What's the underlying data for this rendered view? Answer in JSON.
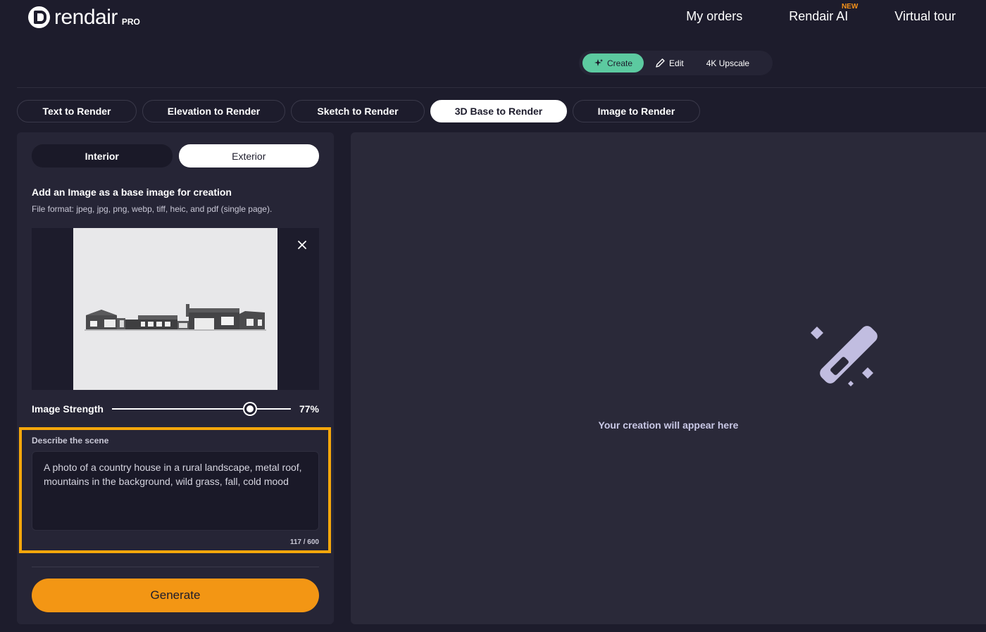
{
  "brand": {
    "name": "rendair",
    "tier": "PRO"
  },
  "nav": {
    "items": [
      {
        "label": "My orders"
      },
      {
        "label": "Rendair AI",
        "badge": "NEW"
      },
      {
        "label": "Virtual tour"
      }
    ]
  },
  "modes": [
    {
      "label": "Create",
      "icon": "sparkle-icon",
      "active": true
    },
    {
      "label": "Edit",
      "icon": "pencil-icon",
      "active": false
    },
    {
      "label": "4K Upscale",
      "icon": "",
      "active": false
    }
  ],
  "tabs": [
    {
      "label": "Text to Render",
      "active": false
    },
    {
      "label": "Elevation to Render",
      "active": false
    },
    {
      "label": "Sketch to Render",
      "active": false
    },
    {
      "label": "3D Base to Render",
      "active": true
    },
    {
      "label": "Image to Render",
      "active": false
    }
  ],
  "panel": {
    "space_toggle": [
      {
        "label": "Interior",
        "active": false
      },
      {
        "label": "Exterior",
        "active": true
      }
    ],
    "upload_title": "Add an Image as a base image for creation",
    "upload_hint": "File format: jpeg, jpg, png, webp, tiff, heic, and pdf (single page).",
    "strength_label": "Image Strength",
    "strength_value": "77%",
    "strength_fraction": 0.77,
    "scene_label": "Describe the scene",
    "scene_text": "A photo of a country house in a rural landscape, metal roof, mountains in the background, wild grass, fall, cold mood",
    "scene_count": "117 / 600",
    "generate_label": "Generate"
  },
  "result": {
    "placeholder": "Your creation will appear here",
    "icon": "magic-wand-icon"
  },
  "colors": {
    "background": "#1d1c2c",
    "accent_orange": "#f39614",
    "accent_green": "#5ccaa0",
    "highlight": "#f5a70b"
  }
}
